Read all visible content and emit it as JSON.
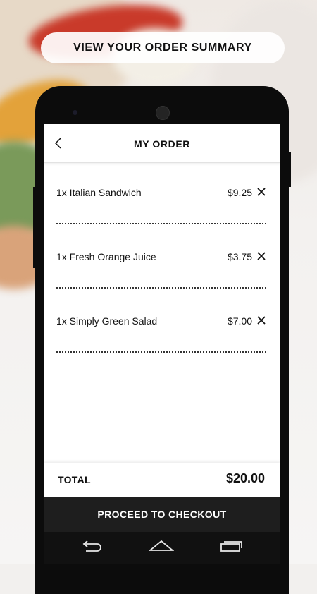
{
  "banner": {
    "text": "VIEW YOUR ORDER SUMMARY"
  },
  "screen": {
    "title": "MY ORDER",
    "items": [
      {
        "name": "1x Italian Sandwich",
        "price": "$9.25"
      },
      {
        "name": "1x Fresh Orange Juice",
        "price": "$3.75"
      },
      {
        "name": "1x Simply Green Salad",
        "price": "$7.00"
      }
    ],
    "total_label": "TOTAL",
    "total_value": "$20.00",
    "checkout_label": "PROCEED TO CHECKOUT"
  },
  "icons": {
    "back": "chevron-left-icon",
    "remove": "close-icon",
    "nav": [
      "back-icon",
      "home-icon",
      "recent-apps-icon"
    ]
  },
  "colors": {
    "text": "#111111",
    "checkout_bg": "#1e1e1e",
    "phone_body": "#0c0c0c"
  }
}
